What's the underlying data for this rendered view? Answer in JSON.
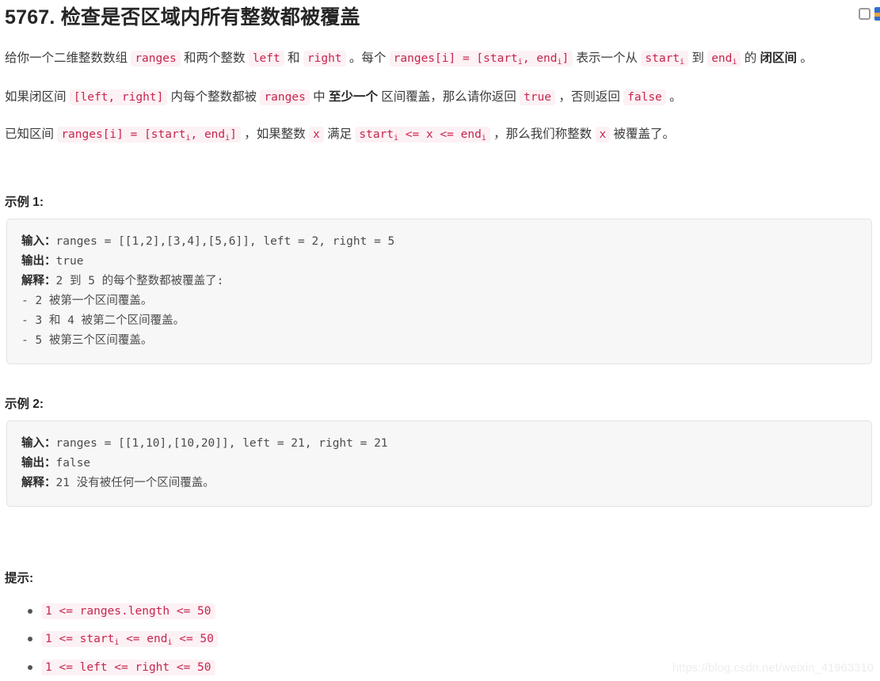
{
  "header": {
    "title": "5767. 检查是否区域内所有整数都被覆盖",
    "bookmark_icon": "bookmark-checkbox",
    "edge_icon": "browser-edge-icon"
  },
  "description": {
    "paragraph_1": {
      "segments": [
        {
          "type": "text",
          "value": "给你一个二维整数数组 "
        },
        {
          "type": "code",
          "value": "ranges"
        },
        {
          "type": "text",
          "value": " 和两个整数 "
        },
        {
          "type": "code",
          "value": "left"
        },
        {
          "type": "text",
          "value": " 和 "
        },
        {
          "type": "code",
          "value": "right"
        },
        {
          "type": "text",
          "value": " 。每个 "
        },
        {
          "type": "code",
          "value": "ranges[i] = [starti, endi]"
        },
        {
          "type": "text",
          "value": " 表示一个从 "
        },
        {
          "type": "code",
          "value": "starti"
        },
        {
          "type": "text",
          "value": " 到 "
        },
        {
          "type": "code",
          "value": "endi"
        },
        {
          "type": "text",
          "value": " 的 "
        },
        {
          "type": "bold",
          "value": "闭区间"
        },
        {
          "type": "text",
          "value": " 。"
        }
      ]
    },
    "paragraph_2": {
      "segments": [
        {
          "type": "text",
          "value": "如果闭区间 "
        },
        {
          "type": "code",
          "value": "[left, right]"
        },
        {
          "type": "text",
          "value": " 内每个整数都被 "
        },
        {
          "type": "code",
          "value": "ranges"
        },
        {
          "type": "text",
          "value": " 中 "
        },
        {
          "type": "bold",
          "value": "至少一个"
        },
        {
          "type": "text",
          "value": " 区间覆盖，那么请你返回 "
        },
        {
          "type": "code",
          "value": "true"
        },
        {
          "type": "text",
          "value": " ，否则返回 "
        },
        {
          "type": "code",
          "value": "false"
        },
        {
          "type": "text",
          "value": " 。"
        }
      ]
    },
    "paragraph_3": {
      "segments": [
        {
          "type": "text",
          "value": "已知区间 "
        },
        {
          "type": "code",
          "value": "ranges[i] = [starti, endi]"
        },
        {
          "type": "text",
          "value": " ，如果整数 "
        },
        {
          "type": "code",
          "value": "x"
        },
        {
          "type": "text",
          "value": " 满足 "
        },
        {
          "type": "code",
          "value": "starti <= x <= endi"
        },
        {
          "type": "text",
          "value": " ，那么我们称整数 "
        },
        {
          "type": "code",
          "value": "x"
        },
        {
          "type": "text",
          "value": " 被覆盖了。"
        }
      ]
    }
  },
  "examples": [
    {
      "heading": "示例 1:",
      "input_label": "输入：",
      "input_value": "ranges = [[1,2],[3,4],[5,6]], left = 2, right = 5",
      "output_label": "输出：",
      "output_value": "true",
      "explain_label": "解释：",
      "explain_value": "2 到 5 的每个整数都被覆盖了:",
      "explain_lines": [
        "- 2 被第一个区间覆盖。",
        "- 3 和 4 被第二个区间覆盖。",
        "- 5 被第三个区间覆盖。"
      ]
    },
    {
      "heading": "示例 2:",
      "input_label": "输入：",
      "input_value": "ranges = [[1,10],[10,20]], left = 21, right = 21",
      "output_label": "输出：",
      "output_value": "false",
      "explain_label": "解释：",
      "explain_value": "21 没有被任何一个区间覆盖。",
      "explain_lines": []
    }
  ],
  "hints": {
    "heading": "提示:",
    "items": [
      {
        "prefix": "1 <= ranges.length <= 50",
        "sub": null
      },
      {
        "prefix": "1 <= start",
        "sub": "i",
        "mid": " <= end",
        "sub2": "i",
        "suffix": " <= 50"
      },
      {
        "prefix": "1 <= left <= right <= 50",
        "sub": null
      }
    ]
  },
  "watermark": "https://blog.csdn.net/weixin_41963310",
  "colors": {
    "code_text": "#c7254e",
    "code_bg": "#fcf1f4",
    "block_bg": "#f7f7f7",
    "block_border": "#e3e3e3",
    "body_text": "#3b3b3b",
    "heading_text": "#262626"
  }
}
